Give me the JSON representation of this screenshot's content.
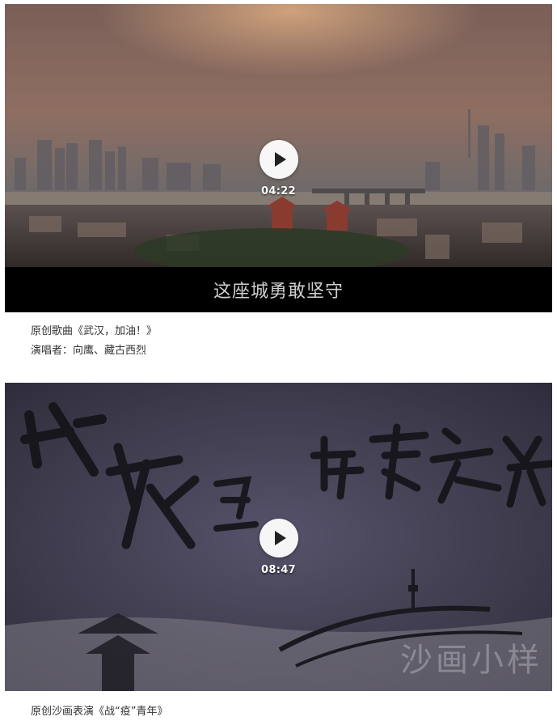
{
  "videos": [
    {
      "duration": "04:22",
      "subtitle": "这座城勇敢坚守",
      "caption_lines": [
        "原创歌曲《武汉，加油！》",
        "演唱者：向鹰、藏古西烈"
      ]
    },
    {
      "duration": "08:47",
      "title_art_text": "战疫里的青春之光",
      "watermark": "沙画小样",
      "caption_lines": [
        "原创沙画表演《战“疫”青年》"
      ]
    }
  ],
  "colors": {
    "text": "#333333",
    "subtitle_bar": "#000000",
    "play_button": "#ffffff"
  },
  "icons": [
    "play-icon"
  ]
}
